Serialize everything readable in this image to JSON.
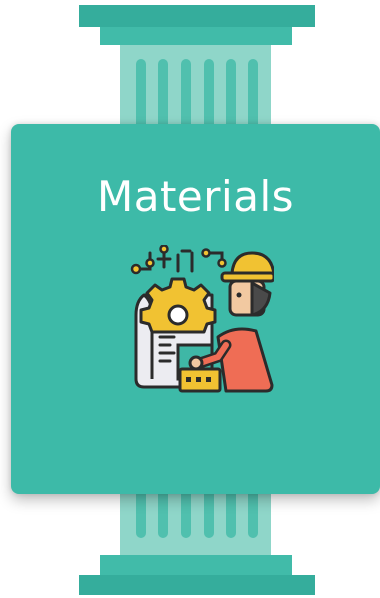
{
  "tile": {
    "title": "Materials",
    "icon": "engineer-with-gear-blueprint-icon"
  },
  "colors": {
    "card": "#3dbaa8",
    "pillar_dark": "#35ad9c",
    "pillar_light": "#8fd6c9",
    "title_text": "#ffffff"
  }
}
